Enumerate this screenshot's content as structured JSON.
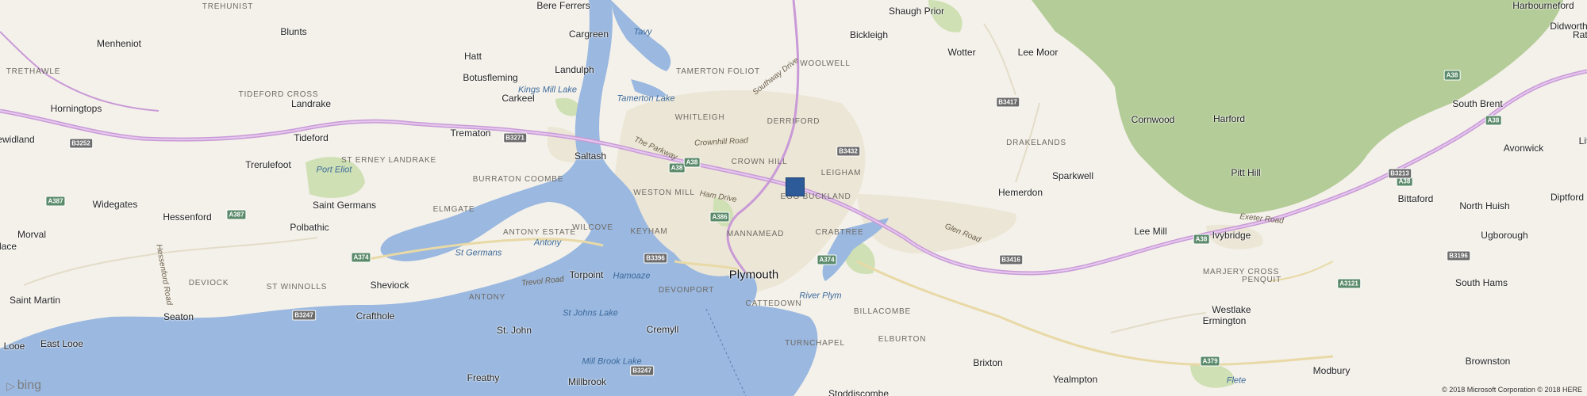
{
  "map": {
    "towns": [
      {
        "name": "Bere Ferrers"
      },
      {
        "name": "Shaugh Prior"
      },
      {
        "name": "Harbourneford"
      },
      {
        "name": "Blunts"
      },
      {
        "name": "Menheniot"
      },
      {
        "name": "Cargreen"
      },
      {
        "name": "Bickleigh"
      },
      {
        "name": "Didworthy"
      },
      {
        "name": "Hatt"
      },
      {
        "name": "Wotter"
      },
      {
        "name": "Lee Moor"
      },
      {
        "name": "Landulph"
      },
      {
        "name": "Botusfleming"
      },
      {
        "name": "Carkeel"
      },
      {
        "name": "Horningtops"
      },
      {
        "name": "Landrake"
      },
      {
        "name": "South Brent"
      },
      {
        "name": "Tideford"
      },
      {
        "name": "Trematon"
      },
      {
        "name": "Cornwood"
      },
      {
        "name": "Harford"
      },
      {
        "name": "ewidland"
      },
      {
        "name": "Saltash"
      },
      {
        "name": "Avonwick"
      },
      {
        "name": "Trerulefoot"
      },
      {
        "name": "Hemerdon"
      },
      {
        "name": "Sparkwell"
      },
      {
        "name": "Pitt Hill"
      },
      {
        "name": "Bittaford"
      },
      {
        "name": "Diptford"
      },
      {
        "name": "Widegates"
      },
      {
        "name": "Saint Germans"
      },
      {
        "name": "Hessenford"
      },
      {
        "name": "North Huish"
      },
      {
        "name": "Polbathic"
      },
      {
        "name": "Lee Mill"
      },
      {
        "name": "Ivybridge"
      },
      {
        "name": "Ugborough"
      },
      {
        "name": "Morval"
      },
      {
        "name": "lace"
      },
      {
        "name": "Torpoint"
      },
      {
        "name": "Sheviock"
      },
      {
        "name": "South Hams"
      },
      {
        "name": "Saint Martin"
      },
      {
        "name": "Seaton"
      },
      {
        "name": "Crafthole"
      },
      {
        "name": "Westlake"
      },
      {
        "name": "St. John"
      },
      {
        "name": "Cremyll"
      },
      {
        "name": "Ermington"
      },
      {
        "name": "Brownston"
      },
      {
        "name": "East Looe"
      },
      {
        "name": "Looe"
      },
      {
        "name": "Brixton"
      },
      {
        "name": "Modbury"
      },
      {
        "name": "Freathy"
      },
      {
        "name": "Yealmpton"
      },
      {
        "name": "Millbrook"
      },
      {
        "name": "Stoddiscombe"
      },
      {
        "name": "Ratt"
      },
      {
        "name": "Lit"
      }
    ],
    "city": {
      "name": "Plymouth"
    },
    "areas": [
      {
        "name": "TREHUNIST"
      },
      {
        "name": "WOOLWELL"
      },
      {
        "name": "TAMERTON FOLIOT"
      },
      {
        "name": "TRETHAWLE"
      },
      {
        "name": "TIDEFORD CROSS"
      },
      {
        "name": "WHITLEIGH"
      },
      {
        "name": "DERRIFORD"
      },
      {
        "name": "ST ERNEY LANDRAKE"
      },
      {
        "name": "DRAKELANDS"
      },
      {
        "name": "CROWN HILL"
      },
      {
        "name": "BURRATON COOMBE"
      },
      {
        "name": "LEIGHAM"
      },
      {
        "name": "WESTON MILL"
      },
      {
        "name": "EGG BUCKLAND"
      },
      {
        "name": "ELMGATE"
      },
      {
        "name": "ANTONY ESTATE"
      },
      {
        "name": "WILCOVE"
      },
      {
        "name": "KEYHAM"
      },
      {
        "name": "MANNAMEAD"
      },
      {
        "name": "CRABTREE"
      },
      {
        "name": "DEVIOCK"
      },
      {
        "name": "ST WINNOLLS"
      },
      {
        "name": "MARJERY CROSS"
      },
      {
        "name": "DEVONPORT"
      },
      {
        "name": "PENQUIT"
      },
      {
        "name": "ANTONY"
      },
      {
        "name": "CATTEDOWN"
      },
      {
        "name": "BILLACOMBE"
      },
      {
        "name": "TURNCHAPEL"
      },
      {
        "name": "ELBURTON"
      }
    ],
    "water": [
      {
        "name": "Tavy"
      },
      {
        "name": "Kings Mill Lake"
      },
      {
        "name": "Tamerton Lake"
      },
      {
        "name": "Port Eliot"
      },
      {
        "name": "St Germans"
      },
      {
        "name": "Antony"
      },
      {
        "name": "Hamoaze"
      },
      {
        "name": "River Plym"
      },
      {
        "name": "St Johns Lake"
      },
      {
        "name": "Mill Brook Lake"
      },
      {
        "name": "Flete"
      }
    ],
    "roads": [
      {
        "name": "Southway Drive"
      },
      {
        "name": "Crownhill Road"
      },
      {
        "name": "The Parkway"
      },
      {
        "name": "Ham Drive"
      },
      {
        "name": "Glen Road"
      },
      {
        "name": "Exeter Road"
      },
      {
        "name": "Trevol Road"
      },
      {
        "name": "Hessenford Road"
      }
    ],
    "shields": [
      {
        "ref": "B3417"
      },
      {
        "name": "B3271",
        "ref": "B3271"
      },
      {
        "ref": "B3252"
      },
      {
        "ref": "B3432"
      },
      {
        "ref": "A38"
      },
      {
        "ref": "A38"
      },
      {
        "ref": "A38"
      },
      {
        "ref": "A38"
      },
      {
        "ref": "A38"
      },
      {
        "ref": "A38"
      },
      {
        "ref": "B3213"
      },
      {
        "ref": "A386"
      },
      {
        "ref": "A387"
      },
      {
        "ref": "A387"
      },
      {
        "ref": "B3396"
      },
      {
        "ref": "A374"
      },
      {
        "ref": "A374"
      },
      {
        "ref": "B3416"
      },
      {
        "ref": "B3196"
      },
      {
        "ref": "A3121"
      },
      {
        "ref": "B3247"
      },
      {
        "ref": "B3247"
      },
      {
        "ref": "A379"
      }
    ]
  },
  "branding": {
    "logo_text": "bing",
    "logo_mark": "▷"
  },
  "copyright": "© 2018 Microsoft Corporation © 2018 HERE",
  "colors": {
    "land": "#f4f1ea",
    "water": "#9ab8e0",
    "moor": "#b4cc98",
    "park": "#cfe0b4",
    "road": "#c99ad7",
    "urban": "#ece6d6",
    "pin": "#2d5b9a"
  }
}
